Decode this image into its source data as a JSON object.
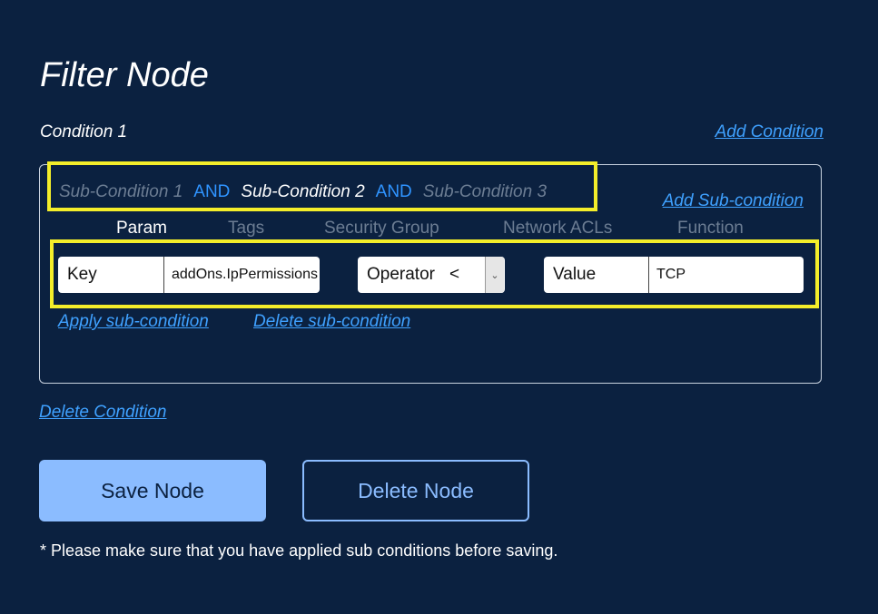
{
  "title": "Filter Node",
  "condition": {
    "label": "Condition 1",
    "add_condition": "Add Condition",
    "delete_condition": "Delete Condition",
    "sub_conditions": [
      {
        "label": "Sub-Condition 1",
        "active": false
      },
      {
        "label": "Sub-Condition 2",
        "active": true
      },
      {
        "label": "Sub-Condition 3",
        "active": false
      }
    ],
    "joiner": "AND",
    "add_sub_condition": "Add Sub-condition",
    "tabs": [
      {
        "label": "Param",
        "active": true
      },
      {
        "label": "Tags",
        "active": false
      },
      {
        "label": "Security Group",
        "active": false
      },
      {
        "label": "Network ACLs",
        "active": false
      },
      {
        "label": "Function",
        "active": false
      }
    ],
    "key": {
      "label": "Key",
      "value": "addOns.IpPermissions"
    },
    "operator": {
      "label": "Operator",
      "value": "<"
    },
    "value": {
      "label": "Value",
      "value": "TCP"
    },
    "apply_sub_condition": "Apply sub-condition",
    "delete_sub_condition": "Delete sub-condition"
  },
  "buttons": {
    "save": "Save Node",
    "delete": "Delete Node"
  },
  "note": "* Please make sure that you have applied sub conditions before saving.",
  "colors": {
    "background": "#0b2140",
    "accent": "#3fa1ff",
    "highlight": "#f4ee2a",
    "primary_button": "#8bbcff"
  }
}
